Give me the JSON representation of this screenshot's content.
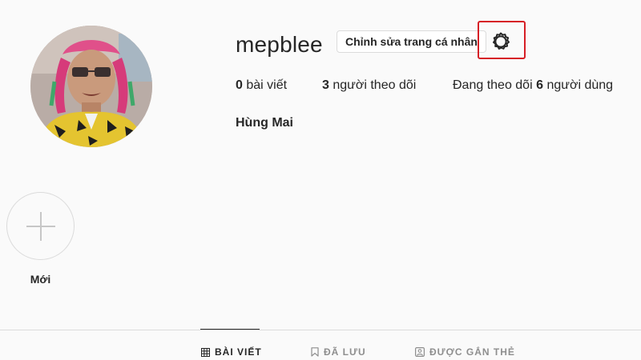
{
  "profile": {
    "username": "mepblee",
    "edit_profile_label": "Chỉnh sửa trang cá nhân",
    "settings_icon": "gear-icon",
    "full_name": "Hùng Mai",
    "avatar_alt": "profile-photo"
  },
  "stats": {
    "posts_count": "0",
    "posts_label": "bài viết",
    "followers_count": "3",
    "followers_label": "người theo dõi",
    "following_prefix": "Đang theo dõi",
    "following_count": "6",
    "following_label": "người dùng"
  },
  "highlights": {
    "new_label": "Mới",
    "new_icon": "plus-icon"
  },
  "tabs": [
    {
      "label": "BÀI VIẾT",
      "icon": "grid-icon",
      "active": true
    },
    {
      "label": "ĐÃ LƯU",
      "icon": "bookmark-icon",
      "active": false
    },
    {
      "label": "ĐƯỢC GẮN THẺ",
      "icon": "tag-person-icon",
      "active": false
    }
  ],
  "colors": {
    "background": "#fafafa",
    "border": "#dbdbdb",
    "text": "#262626",
    "muted": "#8e8e8e",
    "annotation_red": "#d61f26"
  }
}
